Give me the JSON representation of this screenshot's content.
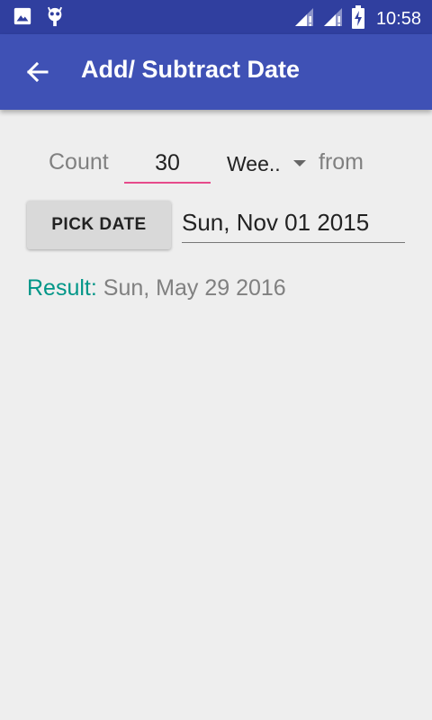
{
  "status_bar": {
    "time": "10:58",
    "icons": [
      "image-icon",
      "debug-android-icon",
      "signal-icon",
      "signal-icon",
      "battery-charging-icon"
    ]
  },
  "app_bar": {
    "title": "Add/ Subtract Date",
    "back_icon": "arrow-back-icon"
  },
  "form": {
    "count_label": "Count",
    "count_value": "30",
    "unit_selected": "Wee..",
    "from_label": "from",
    "pick_date_label": "PICK DATE",
    "date_value": "Sun, Nov 01 2015"
  },
  "result": {
    "label": "Result:",
    "value": "Sun, May 29 2016"
  },
  "colors": {
    "status_bar": "#303f9f",
    "app_bar": "#3f51b5",
    "accent": "#e64a8b",
    "result_label": "#009688"
  }
}
